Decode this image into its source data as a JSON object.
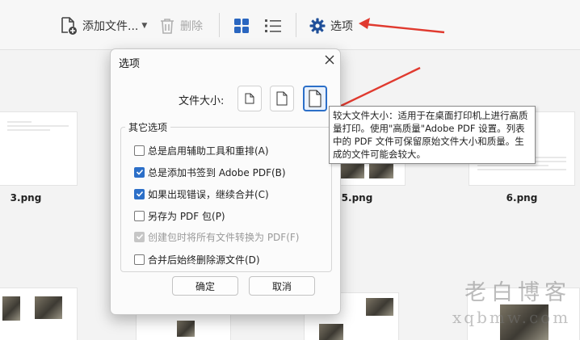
{
  "toolbar": {
    "add_files": "添加文件...",
    "delete": "删除",
    "options": "选项"
  },
  "thumbnails": {
    "labels": [
      "3.png",
      "5.png",
      "6.png"
    ]
  },
  "dialog": {
    "title": "选项",
    "file_size_label": "文件大小:",
    "group_title": "其它选项",
    "options": [
      {
        "label": "总是启用辅助工具和重排(A)",
        "checked": false,
        "disabled": false
      },
      {
        "label": "总是添加书签到 Adobe PDF(B)",
        "checked": true,
        "disabled": false
      },
      {
        "label": "如果出现错误，继续合并(C)",
        "checked": true,
        "disabled": false
      },
      {
        "label": "另存为 PDF 包(P)",
        "checked": false,
        "disabled": false
      },
      {
        "label": "创建包时将所有文件转换为 PDF(F)",
        "checked": true,
        "disabled": true
      },
      {
        "label": "合并后始终删除源文件(D)",
        "checked": false,
        "disabled": false
      }
    ],
    "ok_label": "确定",
    "cancel_label": "取消"
  },
  "tooltip": {
    "text": "较大文件大小：适用于在桌面打印机上进行高质量打印。使用\"高质量\"Adobe PDF 设置。列表中的 PDF 文件可保留原始文件大小和质量。生成的文件可能会较大。"
  },
  "watermark": {
    "line1": "老白博客",
    "line2": "xqbmw.com"
  },
  "colors": {
    "accent": "#2c6fc8",
    "annotation_arrow": "#e03a2f"
  }
}
